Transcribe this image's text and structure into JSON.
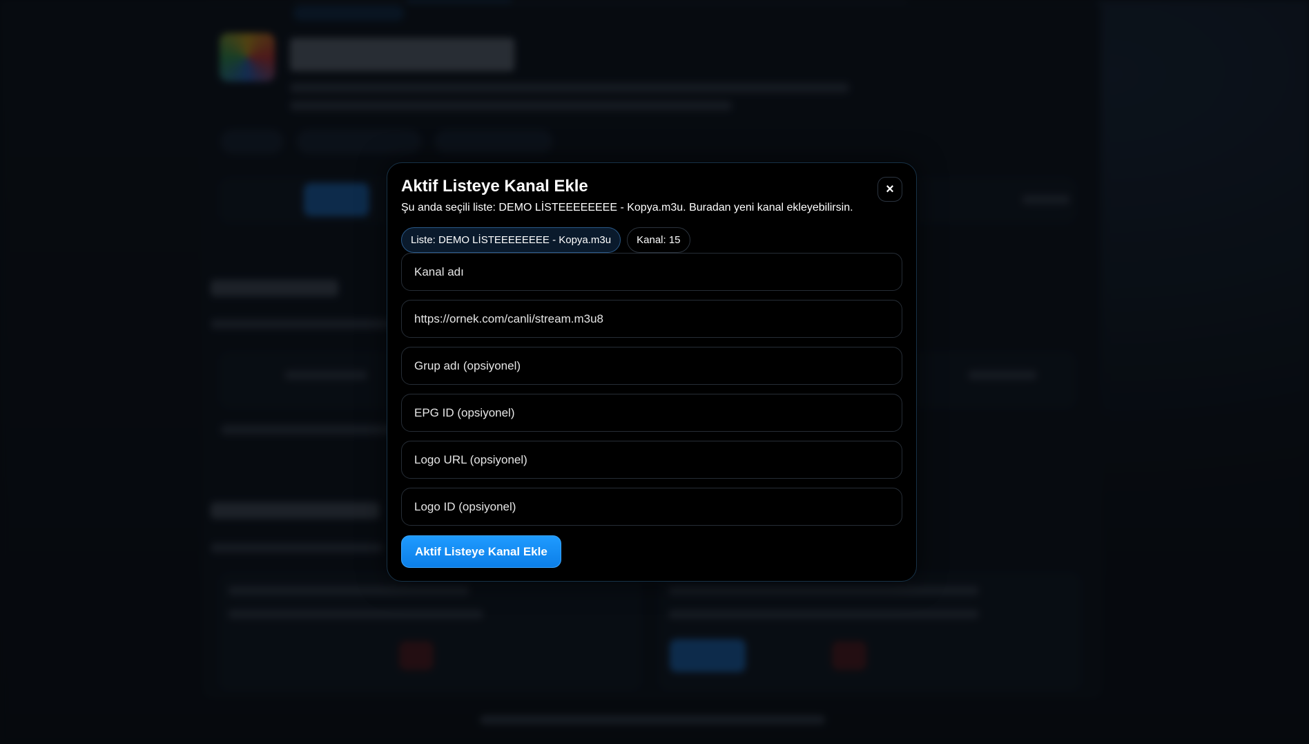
{
  "modal": {
    "title": "Aktif Listeye Kanal Ekle",
    "subtitle": "Şu anda seçili liste: DEMO LİSTEEEEEEEE - Kopya.m3u. Buradan yeni kanal ekleyebilirsin.",
    "close_label": "×",
    "chips": {
      "list": "Liste: DEMO LİSTEEEEEEEE - Kopya.m3u",
      "count": "Kanal: 15"
    },
    "fields": {
      "channel_name": {
        "placeholder": "Kanal adı",
        "value": ""
      },
      "stream_url": {
        "placeholder": "https://ornek.com/canli/stream.m3u8",
        "value": ""
      },
      "group_name": {
        "placeholder": "Grup adı (opsiyonel)",
        "value": ""
      },
      "epg_id": {
        "placeholder": "EPG ID (opsiyonel)",
        "value": ""
      },
      "logo_url": {
        "placeholder": "Logo URL (opsiyonel)",
        "value": ""
      },
      "logo_id": {
        "placeholder": "Logo ID (opsiyonel)",
        "value": ""
      }
    },
    "submit_label": "Aktif Listeye Kanal Ekle"
  },
  "colors": {
    "accent": "#1f9bff",
    "modal_background": "#000000",
    "backdrop": "#0a0f16"
  },
  "icons": {
    "close": "close-icon"
  }
}
